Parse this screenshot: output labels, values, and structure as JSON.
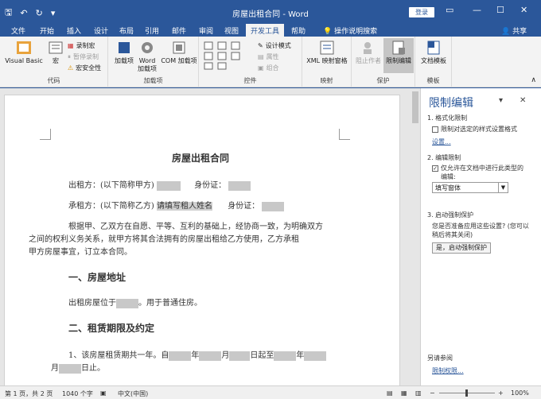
{
  "titlebar": {
    "title": "房屋出租合同 - Word",
    "login": "登录"
  },
  "tabs": [
    "文件",
    "开始",
    "插入",
    "设计",
    "布局",
    "引用",
    "邮件",
    "审阅",
    "视图",
    "开发工具",
    "帮助",
    "操作说明搜索",
    "共享"
  ],
  "ribbon": {
    "code": {
      "label": "代码",
      "vb": "Visual Basic",
      "macro": "宏",
      "record": "录制宏",
      "pause": "暂停录制",
      "security": "宏安全性"
    },
    "addins": {
      "label": "加载项",
      "add": "加载项",
      "word": "Word 加载项",
      "com": "COM 加载项"
    },
    "controls": {
      "label": "控件",
      "design": "设计模式",
      "props": "属性",
      "group": "组合"
    },
    "mapping": {
      "label": "映射",
      "xml": "XML 映射窗格"
    },
    "protect": {
      "label": "保护",
      "block": "阻止作者",
      "restrict": "限制编辑"
    },
    "templates": {
      "label": "模板",
      "doc": "文档模板"
    }
  },
  "doc": {
    "title": "房屋出租合同",
    "lessor": "出租方：(以下简称甲方)",
    "idcard": "身份证：",
    "lessee": "承租方：(以下简称乙方)",
    "placeholder": "请填写租人姓名",
    "idcard2": "身份证：",
    "body1": "根据甲、乙双方在自愿、平等、互利的基础上，经协商一致，为明确双方",
    "body2": "之间的权利义务关系，就甲方将其合法拥有的房屋出租给乙方使用，乙方承租",
    "body3": "甲方房屋事宜，订立本合同。",
    "h1": "一、房屋地址",
    "addr_a": "出租房屋位于",
    "addr_b": "。用于普通住房。",
    "h2": "二、租赁期限及约定",
    "term_a": "1、该房屋租赁期共一年。自",
    "term_y": "年",
    "term_m": "月",
    "term_d": "日起至",
    "term_y2": "年",
    "term_m2": "月",
    "term_end": "日止。"
  },
  "pane": {
    "title": "限制编辑",
    "s1": "1. 格式化限制",
    "c1": "限制对选定的样式设置格式",
    "settings": "设置...",
    "s2": "2. 编辑限制",
    "c2a": "仅允许在文档中进行此类型的",
    "c2b": "编辑:",
    "select": "填写窗体",
    "s3": "3. 启动强制保护",
    "q1": "您是否准备应用这些设置? (您可以",
    "q2": "稍后将其关闭)",
    "btn": "是，启动强制保护",
    "see": "另请参阅",
    "perm": "限制权限..."
  },
  "status": {
    "page": "第 1 页，共 2 页",
    "words": "1040 个字",
    "lang": "中文(中国)",
    "zoom": "100%"
  }
}
